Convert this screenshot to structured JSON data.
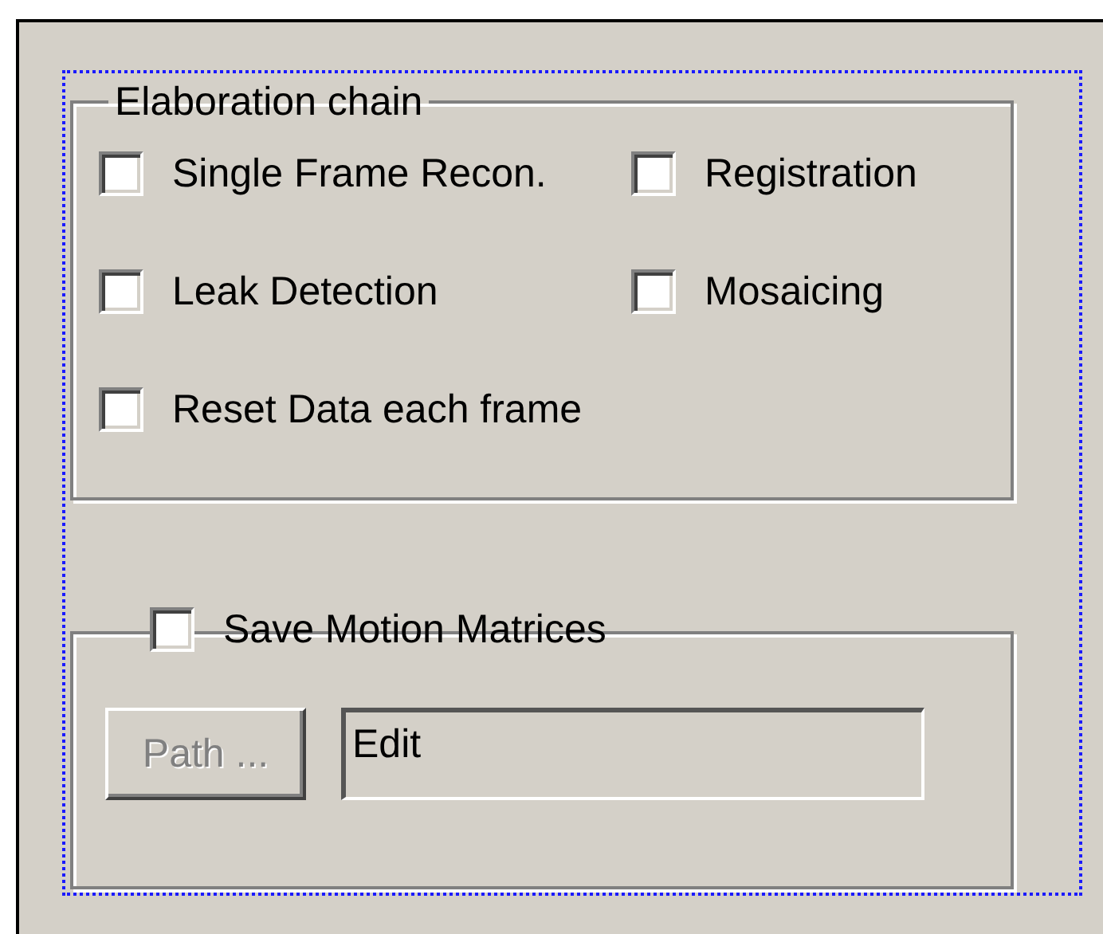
{
  "elaboration_chain": {
    "title": "Elaboration chain",
    "options": [
      {
        "label": "Single Frame Recon.",
        "checked": false
      },
      {
        "label": "Registration",
        "checked": false
      },
      {
        "label": "Leak Detection",
        "checked": false
      },
      {
        "label": "Mosaicing",
        "checked": false
      },
      {
        "label": "Reset Data each frame",
        "checked": false
      }
    ]
  },
  "motion": {
    "save_option": {
      "label": "Save Motion Matrices",
      "checked": false
    },
    "path_button": {
      "label": "Path ...",
      "disabled": true
    },
    "path_field": {
      "value": "Edit",
      "disabled": true
    }
  }
}
